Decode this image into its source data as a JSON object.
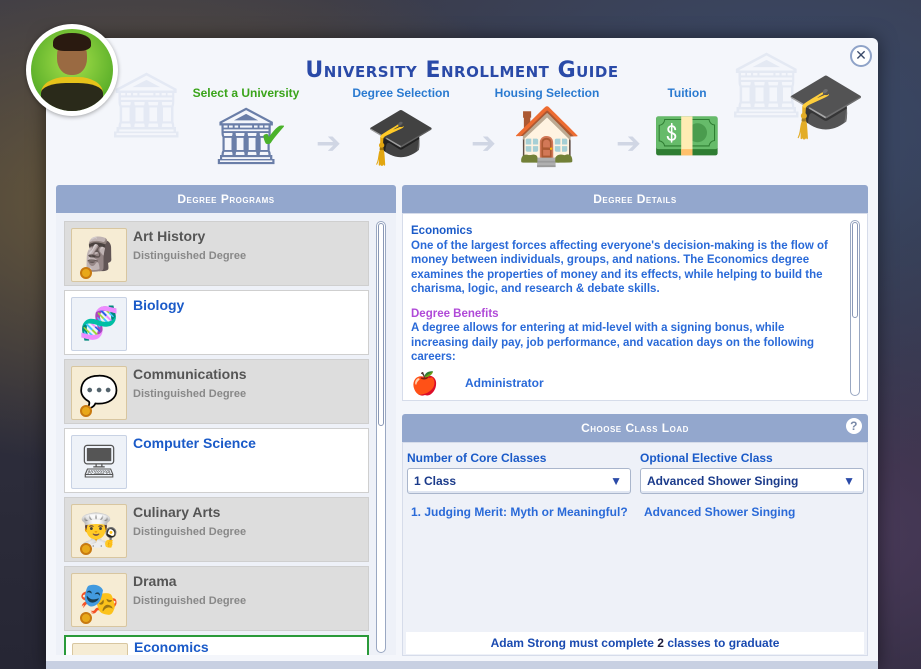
{
  "dialog": {
    "title": "University Enrollment Guide",
    "close_label": "✕"
  },
  "steps": [
    {
      "label": "Select a University",
      "icon": "university-building-icon",
      "state": "done"
    },
    {
      "label": "Degree Selection",
      "icon": "graduation-cap-icon",
      "state": "current"
    },
    {
      "label": "Housing Selection",
      "icon": "house-icon",
      "state": "upcoming"
    },
    {
      "label": "Tuition",
      "icon": "money-icon",
      "state": "upcoming"
    }
  ],
  "degree_programs": {
    "header": "Degree Programs",
    "items": [
      {
        "name": "Art History",
        "sub": "Distinguished Degree",
        "icon": "statue-icon"
      },
      {
        "name": "Biology",
        "sub": "",
        "icon": "dna-icon"
      },
      {
        "name": "Communications",
        "sub": "Distinguished Degree",
        "icon": "speech-bubbles-icon"
      },
      {
        "name": "Computer Science",
        "sub": "",
        "icon": "computer-icon"
      },
      {
        "name": "Culinary Arts",
        "sub": "Distinguished Degree",
        "icon": "chef-hat-icon"
      },
      {
        "name": "Drama",
        "sub": "Distinguished Degree",
        "icon": "theater-masks-icon"
      },
      {
        "name": "Economics",
        "sub": "",
        "icon": "money-icon"
      }
    ]
  },
  "degree_details": {
    "header": "Degree Details",
    "title": "Economics",
    "description": "One of the largest forces affecting everyone's decision-making is the flow of money between individuals, groups, and nations. The Economics degree examines the properties of money and its effects, while helping to build the charisma, logic, and research & debate skills.",
    "benefits_title": "Degree Benefits",
    "benefits_text": "A degree allows for entering at mid-level with a signing bonus, while increasing daily pay, job performance, and vacation days on the following careers:",
    "careers": [
      {
        "label": "Administrator",
        "icon": "apple-icon"
      }
    ]
  },
  "class_load": {
    "header": "Choose Class Load",
    "help": "?",
    "core_label": "Number of Core Classes",
    "core_value": "1 Class",
    "elective_label": "Optional Elective Class",
    "elective_value": "Advanced Shower Singing",
    "core_classes": [
      "1.  Judging Merit: Myth or Meaningful?"
    ],
    "elective_classes": [
      "Advanced Shower Singing"
    ],
    "footer_prefix": "Adam Strong must complete ",
    "footer_count": "2",
    "footer_suffix": " classes to graduate"
  },
  "colors": {
    "accent_blue": "#1a5ac8",
    "done_green": "#3aa41a",
    "header_bg": "#93a7cd",
    "benefits_purple": "#b04ad8"
  }
}
